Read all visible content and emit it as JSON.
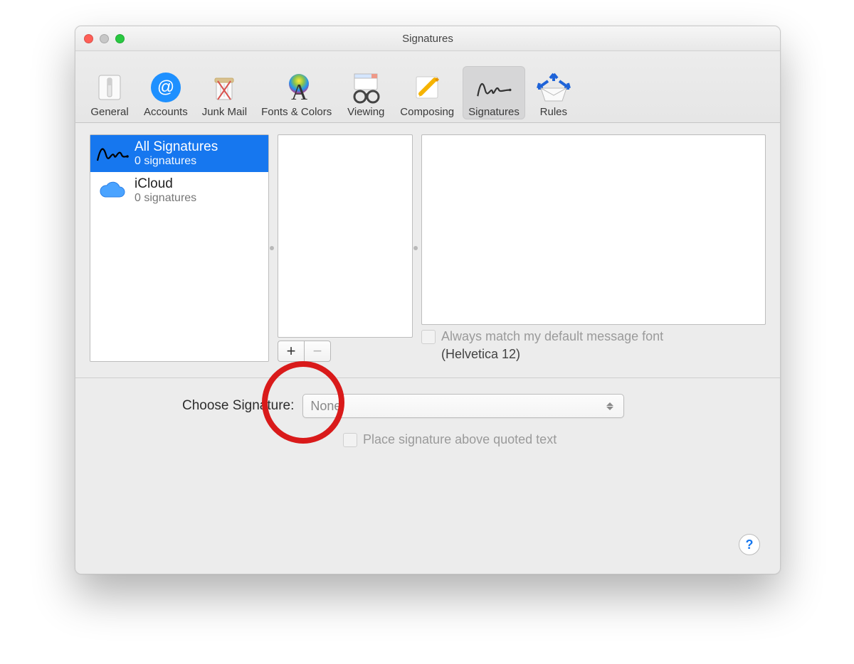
{
  "window": {
    "title": "Signatures"
  },
  "toolbar": {
    "items": [
      {
        "label": "General",
        "name": "general"
      },
      {
        "label": "Accounts",
        "name": "accounts"
      },
      {
        "label": "Junk Mail",
        "name": "junk-mail"
      },
      {
        "label": "Fonts & Colors",
        "name": "fonts-colors"
      },
      {
        "label": "Viewing",
        "name": "viewing"
      },
      {
        "label": "Composing",
        "name": "composing"
      },
      {
        "label": "Signatures",
        "name": "signatures",
        "active": true
      },
      {
        "label": "Rules",
        "name": "rules"
      }
    ]
  },
  "accounts": {
    "items": [
      {
        "name": "All Signatures",
        "sub": "0 signatures",
        "selected": true,
        "icon": "signature"
      },
      {
        "name": "iCloud",
        "sub": "0 signatures",
        "selected": false,
        "icon": "icloud"
      }
    ]
  },
  "buttons": {
    "add": "+",
    "remove": "−"
  },
  "match_font": {
    "label": "Always match my default message font",
    "font_note": "(Helvetica 12)"
  },
  "choose": {
    "label": "Choose Signature:",
    "value": "None"
  },
  "place_above": {
    "label": "Place signature above quoted text"
  },
  "help": "?"
}
